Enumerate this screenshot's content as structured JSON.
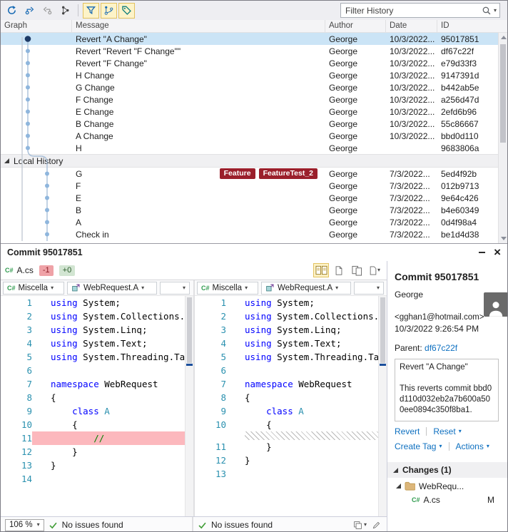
{
  "toolbar": {
    "filter_placeholder": "Filter History"
  },
  "grid": {
    "columns": [
      "Graph",
      "Message",
      "Author",
      "Date",
      "ID"
    ],
    "rows": [
      {
        "message": "Revert \"A Change\"",
        "author": "George",
        "date": "10/3/2022...",
        "id": "95017851"
      },
      {
        "message": "Revert \"Revert \"F Change\"\"",
        "author": "George",
        "date": "10/3/2022...",
        "id": "df67c22f"
      },
      {
        "message": "Revert \"F Change\"",
        "author": "George",
        "date": "10/3/2022...",
        "id": "e79d33f3"
      },
      {
        "message": "H Change",
        "author": "George",
        "date": "10/3/2022...",
        "id": "9147391d"
      },
      {
        "message": "G Change",
        "author": "George",
        "date": "10/3/2022...",
        "id": "b442ab5e"
      },
      {
        "message": "F Change",
        "author": "George",
        "date": "10/3/2022...",
        "id": "a256d47d"
      },
      {
        "message": "E Change",
        "author": "George",
        "date": "10/3/2022...",
        "id": "2efd6b96"
      },
      {
        "message": "B Change",
        "author": "George",
        "date": "10/3/2022...",
        "id": "55c86667"
      },
      {
        "message": "A Change",
        "author": "George",
        "date": "10/3/2022...",
        "id": "bbd0d110"
      },
      {
        "message": "H",
        "author": "George",
        "date": "",
        "id": "9683806a"
      }
    ],
    "local_section_label": "Local History",
    "local_rows": [
      {
        "message": "G",
        "tags": [
          "Feature",
          "FeatureTest_2"
        ],
        "author": "George",
        "date": "7/3/2022...",
        "id": "5ed4f92b"
      },
      {
        "message": "F",
        "author": "George",
        "date": "7/3/2022...",
        "id": "012b9713"
      },
      {
        "message": "E",
        "author": "George",
        "date": "7/3/2022...",
        "id": "9e64c426"
      },
      {
        "message": "B",
        "author": "George",
        "date": "7/3/2022...",
        "id": "b4e60349"
      },
      {
        "message": "A",
        "author": "George",
        "date": "7/3/2022...",
        "id": "0d4f98a4"
      },
      {
        "message": "Check in",
        "author": "George",
        "date": "7/3/2022...",
        "id": "be1d4d38"
      }
    ]
  },
  "commit": {
    "titlebar": "Commit 95017851",
    "tab": {
      "file": "A.cs",
      "removed": "-1",
      "added": "+0"
    },
    "panes": [
      {
        "dropdown1": "Miscella",
        "dropdown2": "WebRequest.A",
        "zoom": "106 %",
        "status": "No issues found",
        "lines": [
          {
            "n": "1",
            "t": [
              [
                "k",
                "using"
              ],
              [
                "p",
                " System;"
              ]
            ]
          },
          {
            "n": "2",
            "t": [
              [
                "k",
                "using"
              ],
              [
                "p",
                " System.Collections.Generic;"
              ]
            ]
          },
          {
            "n": "3",
            "t": [
              [
                "k",
                "using"
              ],
              [
                "p",
                " System.Linq;"
              ]
            ]
          },
          {
            "n": "4",
            "t": [
              [
                "k",
                "using"
              ],
              [
                "p",
                " System.Text;"
              ]
            ]
          },
          {
            "n": "5",
            "t": [
              [
                "k",
                "using"
              ],
              [
                "p",
                " System.Threading.Tasks;"
              ]
            ]
          },
          {
            "n": "6",
            "t": []
          },
          {
            "n": "7",
            "t": [
              [
                "k",
                "namespace"
              ],
              [
                "p",
                " WebRequest"
              ]
            ]
          },
          {
            "n": "8",
            "t": [
              [
                "p",
                "{"
              ]
            ]
          },
          {
            "n": "9",
            "t": [
              [
                "p",
                "    "
              ],
              [
                "k",
                "class"
              ],
              [
                "p",
                " "
              ],
              [
                "t",
                "A"
              ]
            ]
          },
          {
            "n": "10",
            "t": [
              [
                "p",
                "    {"
              ]
            ]
          },
          {
            "n": "11",
            "removed": true,
            "t": [
              [
                "c",
                "        //"
              ]
            ]
          },
          {
            "n": "12",
            "t": [
              [
                "p",
                "    }"
              ]
            ]
          },
          {
            "n": "13",
            "t": [
              [
                "p",
                "}"
              ]
            ]
          },
          {
            "n": "14",
            "t": []
          }
        ]
      },
      {
        "dropdown1": "Miscella",
        "dropdown2": "WebRequest.A",
        "status": "No issues found",
        "lines": [
          {
            "n": "1",
            "t": [
              [
                "k",
                "using"
              ],
              [
                "p",
                " System;"
              ]
            ]
          },
          {
            "n": "2",
            "t": [
              [
                "k",
                "using"
              ],
              [
                "p",
                " System.Collections.Generic;"
              ]
            ]
          },
          {
            "n": "3",
            "t": [
              [
                "k",
                "using"
              ],
              [
                "p",
                " System.Linq;"
              ]
            ]
          },
          {
            "n": "4",
            "t": [
              [
                "k",
                "using"
              ],
              [
                "p",
                " System.Text;"
              ]
            ]
          },
          {
            "n": "5",
            "t": [
              [
                "k",
                "using"
              ],
              [
                "p",
                " System.Threading.Tasks;"
              ]
            ]
          },
          {
            "n": "6",
            "t": []
          },
          {
            "n": "7",
            "t": [
              [
                "k",
                "namespace"
              ],
              [
                "p",
                " WebRequest"
              ]
            ]
          },
          {
            "n": "8",
            "t": [
              [
                "p",
                "{"
              ]
            ]
          },
          {
            "n": "9",
            "t": [
              [
                "p",
                "    "
              ],
              [
                "k",
                "class"
              ],
              [
                "p",
                " "
              ],
              [
                "t",
                "A"
              ]
            ]
          },
          {
            "n": "10",
            "t": [
              [
                "p",
                "    {"
              ]
            ]
          },
          {
            "hatch": true
          },
          {
            "n": "11",
            "t": [
              [
                "p",
                "    }"
              ]
            ]
          },
          {
            "n": "12",
            "t": [
              [
                "p",
                "}"
              ]
            ]
          },
          {
            "n": "13",
            "t": []
          }
        ]
      }
    ],
    "details": {
      "title": "Commit 95017851",
      "author": "George",
      "email": "<gghan1@hotmail.com>",
      "datetime": "10/3/2022 9:26:54 PM",
      "parent_label": "Parent:",
      "parent": "df67c22f",
      "message": "Revert \"A Change\"\n\nThis reverts commit bbd0d110d032eb2a7b600a500ee0894c350f8ba1.",
      "actions": {
        "revert": "Revert",
        "reset": "Reset",
        "create_tag": "Create Tag",
        "actions": "Actions"
      },
      "changes_title": "Changes (1)",
      "folder": "WebRequ...",
      "file": "A.cs",
      "file_status": "M"
    }
  }
}
